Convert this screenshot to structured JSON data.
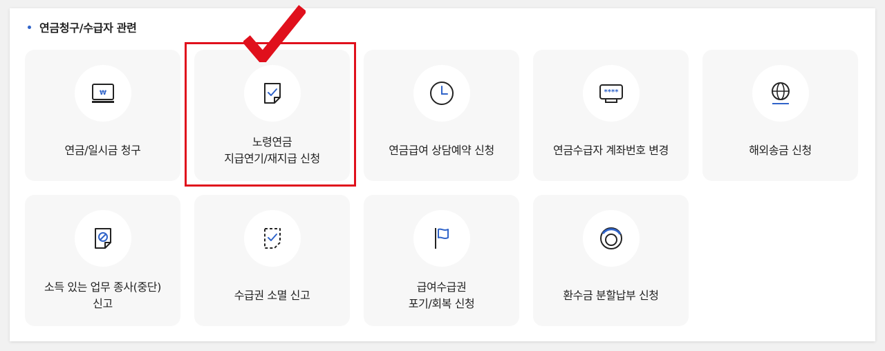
{
  "section": {
    "title": "연금청구/수급자 관련"
  },
  "cards": [
    {
      "lines": [
        "연금/일시금 청구"
      ],
      "icon": "monitor-won-icon"
    },
    {
      "lines": [
        "노령연금",
        "지급연기/재지급 신청"
      ],
      "icon": "document-check-icon"
    },
    {
      "lines": [
        "연금급여 상담예약 신청"
      ],
      "icon": "clock-icon"
    },
    {
      "lines": [
        "연금수급자 계좌번호 변경"
      ],
      "icon": "password-screen-icon"
    },
    {
      "lines": [
        "해외송금 신청"
      ],
      "icon": "globe-icon"
    },
    {
      "lines": [
        "소득 있는 업무 종사(중단)",
        "신고"
      ],
      "icon": "document-prohibited-icon"
    },
    {
      "lines": [
        "수급권 소멸 신고"
      ],
      "icon": "dashed-document-check-icon"
    },
    {
      "lines": [
        "급여수급권",
        "포기/회복 신청"
      ],
      "icon": "flag-icon"
    },
    {
      "lines": [
        "환수금 분할납부 신청"
      ],
      "icon": "ring-chart-icon"
    }
  ],
  "colors": {
    "accent": "#2f63c9",
    "highlight": "#e0101c",
    "card_background": "#f7f7f7"
  },
  "annotation": {
    "highlighted_card": "노령연금 지급연기/재지급 신청"
  }
}
